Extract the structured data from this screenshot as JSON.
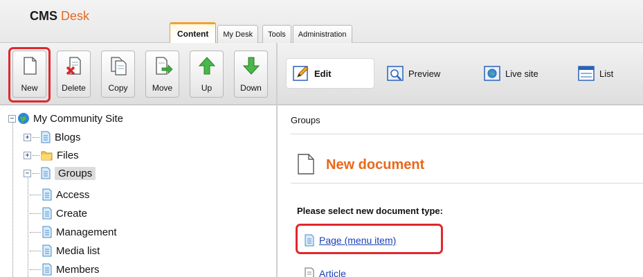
{
  "brand": {
    "name": "CMS",
    "suffix": "Desk"
  },
  "tabs": [
    {
      "label": "Content",
      "active": true
    },
    {
      "label": "My Desk",
      "active": false
    },
    {
      "label": "Tools",
      "active": false
    },
    {
      "label": "Administration",
      "active": false
    }
  ],
  "toolbar": {
    "new": "New",
    "delete": "Delete",
    "copy": "Copy",
    "move": "Move",
    "up": "Up",
    "down": "Down"
  },
  "views": {
    "edit": "Edit",
    "preview": "Preview",
    "live_site": "Live site",
    "list": "List"
  },
  "tree": {
    "root": "My Community Site",
    "blogs": "Blogs",
    "files": "Files",
    "groups": "Groups",
    "access": "Access",
    "create": "Create",
    "management": "Management",
    "media_list": "Media list",
    "members": "Members"
  },
  "content": {
    "breadcrumb": "Groups",
    "title": "New document",
    "prompt": "Please select new document type:",
    "types": [
      "Page (menu item)",
      "Article"
    ]
  },
  "colors": {
    "accent": "#e8681b",
    "highlight": "#e0272c",
    "link": "#1a3fb5"
  }
}
